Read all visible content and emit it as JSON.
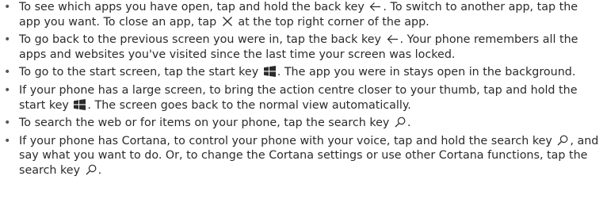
{
  "items": [
    {
      "segments": [
        {
          "text": "To see which apps you have open, tap and hold the back key "
        },
        {
          "icon": "back-arrow-icon"
        },
        {
          "text": ". To switch to another app, tap the app you want. To close an app, tap "
        },
        {
          "icon": "close-icon"
        },
        {
          "text": " at the top right corner of the app."
        }
      ]
    },
    {
      "segments": [
        {
          "text": "To go back to the previous screen you were in, tap the back key "
        },
        {
          "icon": "back-arrow-icon"
        },
        {
          "text": ". Your phone remembers all the apps and websites you've visited since the last time your screen was locked."
        }
      ]
    },
    {
      "segments": [
        {
          "text": "To go to the start screen, tap the start key "
        },
        {
          "icon": "windows-start-icon"
        },
        {
          "text": ". The app you were in stays open in the background."
        }
      ]
    },
    {
      "segments": [
        {
          "text": "If your phone has a large screen, to bring the action centre closer to your thumb, tap and hold the start key "
        },
        {
          "icon": "windows-start-icon"
        },
        {
          "text": ". The screen goes back to the normal view automatically."
        }
      ]
    },
    {
      "segments": [
        {
          "text": "To search the web or for items on your phone, tap the search key "
        },
        {
          "icon": "search-icon"
        },
        {
          "text": "."
        }
      ]
    },
    {
      "segments": [
        {
          "text": "If your phone has Cortana, to control your phone with your voice, tap and hold the search key "
        },
        {
          "icon": "search-icon"
        },
        {
          "text": ", and say what you want to do. Or, to change the Cortana settings or use other Cortana functions, tap the search key "
        },
        {
          "icon": "search-icon"
        },
        {
          "text": "."
        }
      ]
    }
  ],
  "bullet_glyph": "•"
}
